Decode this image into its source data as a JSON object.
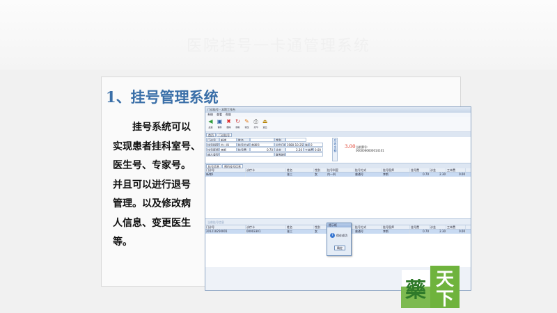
{
  "slide": {
    "title": "1、挂号管理系统",
    "body_lines": [
      "挂号系统可以",
      "实现患者挂科室号、",
      "医生号、专家号。",
      "并且可以进行退号",
      "管理。以及修改病",
      "人信息、变更医生",
      "等。"
    ],
    "header_faint": "医院挂号一卡通管理系统"
  },
  "app": {
    "window_title": "门诊挂号 - 本院工作台",
    "menu": [
      "系统",
      "查看",
      "帮助"
    ],
    "toolbar": [
      {
        "icon": "back-arrow-icon",
        "label": "后退"
      },
      {
        "icon": "save-icon",
        "label": "保存"
      },
      {
        "icon": "delete-icon",
        "label": "删除"
      },
      {
        "icon": "refresh-icon",
        "label": "刷新"
      },
      {
        "icon": "edit-icon",
        "label": "修改"
      },
      {
        "icon": "print-icon",
        "label": "打印"
      },
      {
        "icon": "exit-icon",
        "label": "退出"
      }
    ],
    "tabs": [
      "首页",
      "门诊挂号"
    ],
    "form": {
      "card_label": "门诊号",
      "card_value": "新增",
      "name_label": "姓名",
      "name_value": "",
      "gender_label": "性别",
      "gender_value": "",
      "dept_label": "挂号科室",
      "dept_value": "内一科",
      "type_label": "挂号方式",
      "type_value": "普通号",
      "birth_label": "出生日期",
      "birth_value": "1980-10-25",
      "age_label": "年龄",
      "age_value": "0",
      "doctor_label": "挂号医师",
      "doctor_value": "李斯",
      "fee_label": "挂号费",
      "fee_value": "0.70",
      "deposit_label": "诊金",
      "deposit_value": "2.30",
      "workfee_label": "工本费",
      "workfee_value": "0.00",
      "type2_label": "病人类型",
      "address_label": "联系地址",
      "total_label": "应收金额",
      "total_value": "3.00",
      "invoice_label": "当前票号:",
      "invoice_value": "0000066600014101"
    },
    "grid_tabs": [
      "挂号信息",
      "预约挂号信息"
    ],
    "grid_headers": [
      "门诊号",
      "诊疗卡",
      "姓名",
      "性别",
      "挂号科室",
      "挂号方式",
      "挂号医师",
      "挂号费",
      "诊金",
      "工本费"
    ],
    "grid_rows": [
      [
        "新增1",
        "",
        "张三",
        "女",
        "内一科",
        "普通号",
        "李斯",
        "0.70",
        "2.30",
        "0.00"
      ]
    ],
    "grid2_label": "当前挂号信息",
    "grid2_rows": [
      [
        "201210250001",
        "00003301",
        "张三",
        "女",
        "内一科",
        "普通号",
        "李斯",
        "0.70",
        "2.30",
        "0.00"
      ]
    ],
    "dialog": {
      "title": "提示框",
      "message": "保存成功",
      "ok_label": "确定"
    }
  },
  "logo_text": "药天下"
}
